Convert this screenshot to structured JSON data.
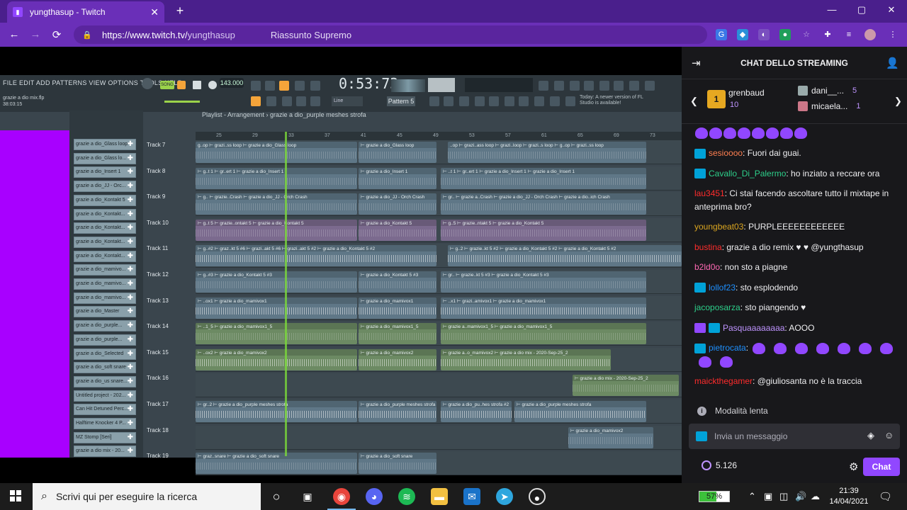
{
  "browser": {
    "tab_title": "yungthasup - Twitch",
    "tab_close": "✕",
    "new_tab": "+",
    "url_domain": "https://www.twitch.tv/",
    "url_path": "yungthasup",
    "omnibox_hint": "Riassunto Supremo",
    "back": "←",
    "forward": "→",
    "reload": "⟳",
    "minimize": "—",
    "maximize": "▢",
    "close": "✕"
  },
  "fl": {
    "menu": "FILE  EDIT  ADD  PATTERNS  VIEW  OPTIONS  TOOLS  HELP",
    "time": "0:53:73",
    "bpm": "143.000",
    "project_file": "grazie a dio mix.flp",
    "project_time": "38:03:15",
    "pattern": "Pattern 5",
    "news": "Today: A newer version of FL Studio is available!",
    "playlist_title": "Playlist - Arrangement › grazie a dio_purple meshes strofa",
    "ruler": [
      "25",
      "29",
      "33",
      "37",
      "41",
      "45",
      "49",
      "53",
      "57",
      "61",
      "65",
      "69",
      "73"
    ],
    "browser_items": [
      "grazie a dio_Glass loop",
      "grazie a dio_Glass lo...",
      "grazie a dio_Insert 1",
      "grazie a dio_JJ - Orc...",
      "grazie a dio_Kontakt 5",
      "grazie a dio_Kontakt...",
      "grazie a dio_Kontakt...",
      "grazie a dio_Kontakt...",
      "grazie a dio_Kontakt...",
      "grazie a dio_mamivo...",
      "grazie a dio_mamivo...",
      "grazie a dio_mamivo...",
      "grazie a dio_Master",
      "grazie a dio_purple...",
      "grazie a dio_purple...",
      "grazie a dio_Selected",
      "grazie a dio_soft snare",
      "grazie a dio_us snare...",
      "Untitled project - 202...",
      "Can Hit Detuned Perc...",
      "Halftime Knocker 4 P...",
      "MZ Stomp [Seri]",
      "grazie a dio mix - 20..."
    ],
    "tracks": [
      {
        "label": "Track 7",
        "clips": [
          "g..op ⊢ grazi..ss loop ⊢ grazie a dio_Glass loop",
          "⊢ grazie a dio_Glass loop",
          "..op ⊢ grazi..ass loop ⊢ grazi..loop ⊢ grazi..s loop ⊢ g..op ⊢ grazi..ss loop"
        ]
      },
      {
        "label": "Track 8",
        "clips": [
          "⊢ g..t 1 ⊢ gr..ert 1 ⊢ grazie a dio_Insert 1",
          "⊢ grazie a dio_Insert 1",
          "⊢ ..t 1 ⊢ gr..ert 1 ⊢ grazie a dio_Insert 1 ⊢ grazie a dio_Insert 1"
        ]
      },
      {
        "label": "Track 9",
        "clips": [
          "⊢ g.. ⊢ grazie..Crash ⊢ grazie a dio_JJ - Orch Crash",
          "⊢ grazie a dio_JJ - Orch Crash",
          "⊢ gr.. ⊢ grazie a..Crash ⊢ grazie a dio_JJ - Orch Crash ⊢ grazie a dio..ich Crash"
        ]
      },
      {
        "label": "Track 10",
        "clips": [
          "⊢ g..t 5 ⊢ grazie..ontakt 5 ⊢ grazie a dio_Kontakt 5",
          "⊢ grazie a dio_Kontakt 5",
          "⊢ g..5 ⊢ grazie..ntakt 5 ⊢ grazie a dio_Kontakt 5"
        ]
      },
      {
        "label": "Track 11",
        "clips": [
          "⊢ g..#2 ⊢ graz..kt 5 #6 ⊢ grazi..akt 5 #6 ⊢ grazi..akt 5 #2 ⊢ grazie a dio_Kontakt 5 #2",
          "⊢ g..2 ⊢ grazie..kt 5 #2 ⊢ grazie a dio_Kontakt 5 #2 ⊢ grazie a dio_Kontakt 5 #2"
        ]
      },
      {
        "label": "Track 12",
        "clips": [
          "⊢ g..#3 ⊢ grazie a dio_Kontakt 5 #3",
          "⊢ grazie a dio_Kontakt 5 #3",
          "⊢ gr.. ⊢ grazie..kt 5 #3 ⊢ grazie a dio_Kontakt 5 #3"
        ]
      },
      {
        "label": "Track 13",
        "clips": [
          "⊢ ..ox1 ⊢ grazie a dio_mamivox1",
          "⊢ grazie a dio_mamivox1",
          "⊢ ..x1 ⊢ grazi..amivox1 ⊢ grazie a dio_mamivox1"
        ]
      },
      {
        "label": "Track 14",
        "clips": [
          "⊢ ..1_5 ⊢ grazie a dio_mamivox1_5",
          "⊢ grazie a dio_mamivox1_5",
          "⊢ grazie a..mamivox1_5 ⊢ grazie a dio_mamivox1_5"
        ]
      },
      {
        "label": "Track 15",
        "clips": [
          "⊢ ..ox2 ⊢ grazie a dio_mamivox2",
          "⊢ grazie a dio_mamivox2",
          "⊢ grazie a..o_mamivox2 ⊢ grazie a dio mix - 2020-Sep-25_2"
        ]
      },
      {
        "label": "Track 16",
        "clips": [
          "⊢ grazie a dio mix - 2020-Sep-25_2"
        ]
      },
      {
        "label": "Track 17",
        "clips": [
          "⊢ gr..2 ⊢ grazie a dio_purple meshes strofa",
          "⊢ grazie a dio_purple meshes strofa",
          "⊢ grazie a dio_pu..hes strofa #2",
          "⊢ grazie a dio_purple meshes strofa"
        ]
      },
      {
        "label": "Track 18",
        "clips": [
          "⊢ grazie a dio_mamivox2"
        ]
      },
      {
        "label": "Track 19",
        "clips": [
          "⊢ graz..snare ⊢ grazie a dio_soft snare",
          "⊢ grazie a dio_soft snare"
        ]
      }
    ]
  },
  "chat": {
    "header": "CHAT DELLO STREAMING",
    "gifts": {
      "top_user": "grenbaud",
      "top_count": "10",
      "top_rank": "1",
      "user2": "dani__...",
      "user2_count": "5",
      "user3": "micaela...",
      "user3_count": "1"
    },
    "messages": [
      {
        "user": "",
        "color": "#bf94ff",
        "text": ""
      },
      {
        "user": "sesioooo",
        "color": "#ff7f50",
        "text": ": Fuori dai guai."
      },
      {
        "user": "Cavallo_Di_Palermo",
        "color": "#2dcf8a",
        "text": ": ho inziato a reccare ora"
      },
      {
        "user": "lau3451",
        "color": "#ff2c2c",
        "text": ": Ci stai facendo ascoltare tutto il mixtape in anteprima bro?"
      },
      {
        "user": "youngbeat03",
        "color": "#daa520",
        "text": ": PURPLEEEEEEEEEEEE"
      },
      {
        "user": "bustina",
        "color": "#ff2c2c",
        "text": ": grazie a dio remix ♥ ♥ @yungthasup"
      },
      {
        "user": "b2ld0o",
        "color": "#ff69b4",
        "text": ": non sto a piagne"
      },
      {
        "user": "lollof23",
        "color": "#1e90ff",
        "text": ": sto esplodendo"
      },
      {
        "user": "jacoposarza",
        "color": "#2dcf8a",
        "text": ": sto piangendo ♥"
      },
      {
        "user": "Pasquaaaaaaaa",
        "color": "#bf94ff",
        "text": ": AOOO"
      },
      {
        "user": "pietrocata",
        "color": "#1e90ff",
        "text": ":"
      },
      {
        "user": "maickthegamer",
        "color": "#ff2c2c",
        "text": ": @giuliosanta  no è la traccia"
      }
    ],
    "slow_mode": "Modalità lenta",
    "input_placeholder": "Invia un messaggio",
    "viewers": "5.126",
    "chat_button": "Chat"
  },
  "taskbar": {
    "search_placeholder": "Scrivi qui per eseguire la ricerca",
    "battery": "57%",
    "time": "21:39",
    "date": "14/04/2021"
  },
  "colors": {
    "twitch_purple": "#9147ff",
    "browser_frame": "#6a2fb8",
    "fl_background": "#3a454d",
    "clip_blue": "#5f7787",
    "clip_purple": "#7b6a8e",
    "clip_green": "#6c8a63",
    "magenta_panel": "#a800ff"
  }
}
